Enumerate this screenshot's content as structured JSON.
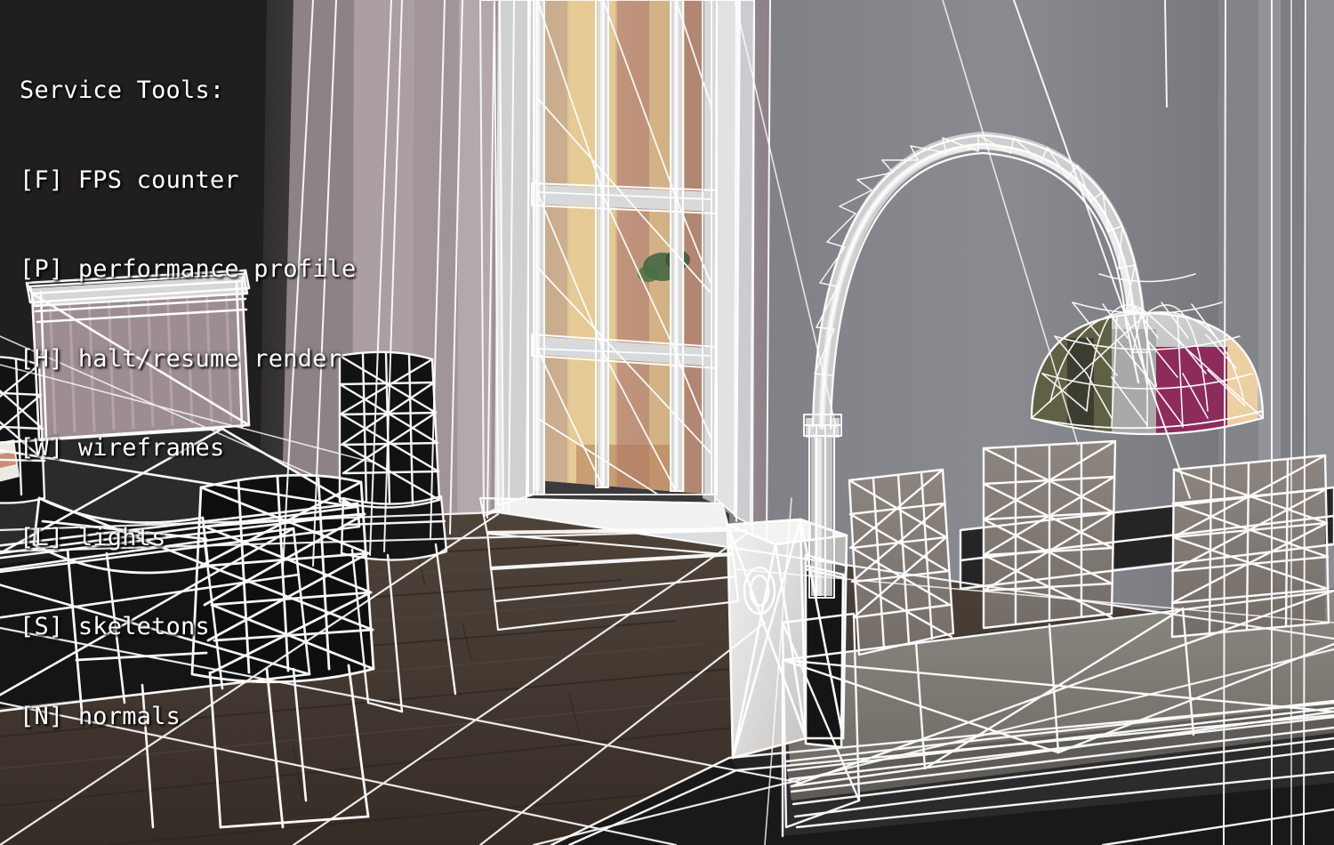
{
  "overlay": {
    "title": "Service Tools:",
    "items": [
      {
        "key": "[F]",
        "label": "FPS counter"
      },
      {
        "key": "[P]",
        "label": "performance profile"
      },
      {
        "key": "[H]",
        "label": "halt/resume render"
      },
      {
        "key": "[W]",
        "label": "wireframes"
      },
      {
        "key": "[L]",
        "label": "lights"
      },
      {
        "key": "[S]",
        "label": "skeletons"
      },
      {
        "key": "[N]",
        "label": "normals"
      }
    ],
    "text_color": "#ffffff",
    "font": "monospace"
  },
  "scene": {
    "description": "3D interior viewport with wireframe debug overlay enabled",
    "objects": [
      "dining-table",
      "dining-chairs",
      "radiator",
      "window",
      "curtain-panels",
      "arc-floor-lamp",
      "lamp-dome-shade",
      "marble-side-table",
      "sofa",
      "sofa-cushions",
      "wood-floor",
      "area-rug",
      "wall-left",
      "wall-right"
    ],
    "colors": {
      "wireframe": "#ffffff",
      "wall_grey": "#86868c",
      "wall_grey_dark": "#6f7076",
      "wall_mauve": "#9b8e92",
      "wall_shadow": "#221f20",
      "floor_wood": "#463b34",
      "floor_wood_dark": "#332b26",
      "sofa_taupe": "#7e7a74",
      "table_black": "#232325",
      "rug_black": "#181818",
      "window_exterior": "#d9bb86",
      "window_exterior_warm": "#c9a07f",
      "lamp_accent_magenta": "#8e2b5e",
      "lamp_accent_olive": "#6a6a4a",
      "lamp_accent_cream": "#e8cfa8",
      "trim_white": "#e9e9ea",
      "radiator_mauve": "#94848b"
    }
  }
}
